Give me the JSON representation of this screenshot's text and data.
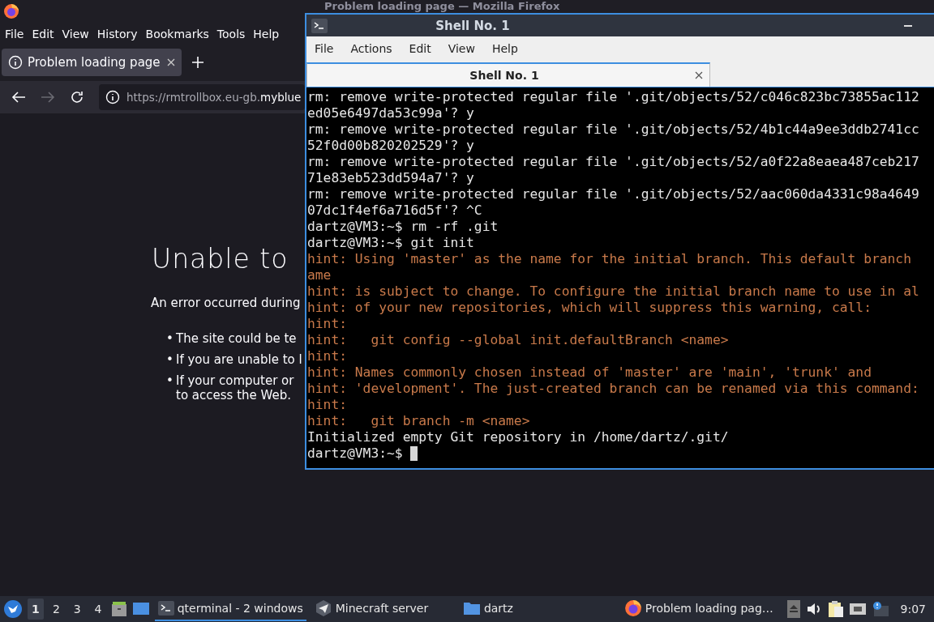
{
  "firefox": {
    "title": "Problem loading page — Mozilla Firefox",
    "menu": [
      "File",
      "Edit",
      "View",
      "History",
      "Bookmarks",
      "Tools",
      "Help"
    ],
    "tab": {
      "label": "Problem loading page",
      "selected": true
    },
    "url": "https://rmtrollbox.eu-gb.**myblue**",
    "page": {
      "heading": "Unable to",
      "intro": "An error occurred during",
      "bullets": [
        {
          "marker": "•",
          "lines": [
            "The site could be te"
          ]
        },
        {
          "marker": "•",
          "lines": [
            "If you are unable to l"
          ]
        },
        {
          "marker": "•",
          "lines": [
            "If your computer or",
            "to access the Web."
          ]
        }
      ]
    }
  },
  "terminal": {
    "title": "Shell No. 1",
    "menu": [
      "File",
      "Actions",
      "Edit",
      "View",
      "Help"
    ],
    "tabs": [
      {
        "label": "Shell No. 1",
        "selected": true
      }
    ],
    "lines": [
      {
        "kind": "output",
        "text": "rm: remove write-protected regular file '.git/objects/52/c046c823bc73855ac112"
      },
      {
        "kind": "output",
        "text": "ed05e6497da53c99a'? y"
      },
      {
        "kind": "output",
        "text": "rm: remove write-protected regular file '.git/objects/52/4b1c44a9ee3ddb2741cc"
      },
      {
        "kind": "output",
        "text": "52f0d00b820202529'? y"
      },
      {
        "kind": "output",
        "text": "rm: remove write-protected regular file '.git/objects/52/a0f22a8eaea487ceb217"
      },
      {
        "kind": "output",
        "text": "71e83eb523dd594a7'? y"
      },
      {
        "kind": "output",
        "text": "rm: remove write-protected regular file '.git/objects/52/aac060da4331c98a4649"
      },
      {
        "kind": "output",
        "text": "07dc1f4ef6a716d5f'? ^C"
      },
      {
        "kind": "prompt",
        "text": "dartz@VM3:~$ rm -rf .git"
      },
      {
        "kind": "prompt",
        "text": "dartz@VM3:~$ git init"
      },
      {
        "kind": "hint",
        "text": "hint: Using 'master' as the name for the initial branch. This default branch"
      },
      {
        "kind": "hint",
        "text": "ame"
      },
      {
        "kind": "hint",
        "text": "hint: is subject to change. To configure the initial branch name to use in al"
      },
      {
        "kind": "hint",
        "text": "hint: of your new repositories, which will suppress this warning, call:"
      },
      {
        "kind": "hint",
        "text": "hint:"
      },
      {
        "kind": "hint",
        "text": "hint:   git config --global init.defaultBranch <name>"
      },
      {
        "kind": "hint",
        "text": "hint:"
      },
      {
        "kind": "hint",
        "text": "hint: Names commonly chosen instead of 'master' are 'main', 'trunk' and"
      },
      {
        "kind": "hint",
        "text": "hint: 'development'. The just-created branch can be renamed via this command:"
      },
      {
        "kind": "hint",
        "text": "hint:"
      },
      {
        "kind": "hint",
        "text": "hint:   git branch -m <name>"
      },
      {
        "kind": "output",
        "text": "Initialized empty Git repository in /home/dartz/.git/"
      },
      {
        "kind": "prompt",
        "text": "dartz@VM3:~$"
      }
    ]
  },
  "taskbar": {
    "workspaces": [
      {
        "label": "1",
        "selected": true
      },
      {
        "label": "2",
        "selected": false
      },
      {
        "label": "3",
        "selected": false
      },
      {
        "label": "4",
        "selected": false
      }
    ],
    "tasks": [
      {
        "kind": "terminal",
        "label": "qterminal - 2 windows",
        "selected": true
      },
      {
        "kind": "plane",
        "label": "Minecraft server",
        "selected": false
      },
      {
        "kind": "folder",
        "label": "dartz",
        "selected": false
      },
      {
        "kind": "firefox",
        "label": "Problem loading pag…",
        "selected": false
      }
    ],
    "clock": "9:07"
  }
}
